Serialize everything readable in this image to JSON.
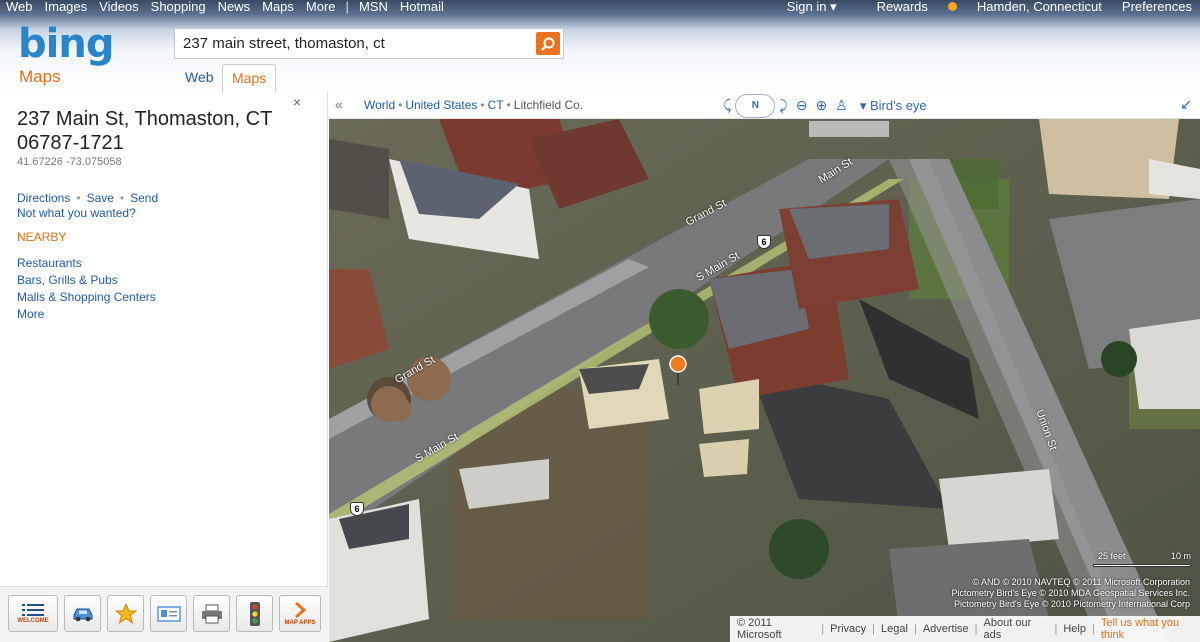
{
  "topnav": {
    "items": [
      "Web",
      "Images",
      "Videos",
      "Shopping",
      "News",
      "Maps",
      "More"
    ],
    "sep": "|",
    "extra": [
      "MSN",
      "Hotmail"
    ]
  },
  "topright": {
    "signin": "Sign in ▾",
    "rewards": "Rewards",
    "location": "Hamden, Connecticut",
    "preferences": "Preferences"
  },
  "brand": {
    "logo": "bing",
    "sub": "Maps",
    "logo_color": "#2a84c9",
    "accent_color": "#e26e16"
  },
  "search": {
    "value": "237 main street, thomaston, ct",
    "button_icon": "search-icon"
  },
  "verticals": {
    "web": "Web",
    "maps": "Maps"
  },
  "result": {
    "close": "×",
    "address_line1": "237 Main St, Thomaston, CT",
    "address_line2": "06787-1721",
    "coords": "41.67226 -73.075058",
    "actions": [
      "Directions",
      "Save",
      "Send"
    ],
    "not_what": "Not what you wanted?",
    "nearby_title": "NEARBY",
    "nearby": [
      "Restaurants",
      "Bars, Grills & Pubs",
      "Malls & Shopping Centers",
      "More"
    ]
  },
  "toolbar": {
    "welcome": "WELCOME",
    "map_apps": "MAP APPS",
    "icons": [
      "list-icon",
      "car-icon",
      "star-icon",
      "card-icon",
      "printer-icon",
      "traffic-light-icon",
      "arrow-right-icon"
    ]
  },
  "mapbar": {
    "collapse": "«",
    "breadcrumb": [
      "World",
      "United States",
      "CT"
    ],
    "breadcrumb_last": "Litchfield Co.",
    "compass": "N",
    "view": "Bird's eye",
    "expand": "↙"
  },
  "map": {
    "labels": [
      "Grand St",
      "Main St",
      "S Main St",
      "Grand St",
      "S Main St",
      "Union St"
    ],
    "route_shields": [
      "6",
      "6"
    ],
    "scale": {
      "feet": "25 feet",
      "meters": "10 m"
    },
    "copyright": [
      "© AND  © 2010 NAVTEQ  © 2011 Microsoft Corporation",
      "Pictometry Bird's Eye © 2010 MDA Geospatial Services Inc.",
      "Pictometry Bird's Eye © 2010 Pictometry International Corp"
    ]
  },
  "footer": {
    "copyright": "© 2011 Microsoft",
    "links": [
      "Privacy",
      "Legal",
      "Advertise",
      "About our ads",
      "Help"
    ],
    "tell": "Tell us what you think"
  }
}
